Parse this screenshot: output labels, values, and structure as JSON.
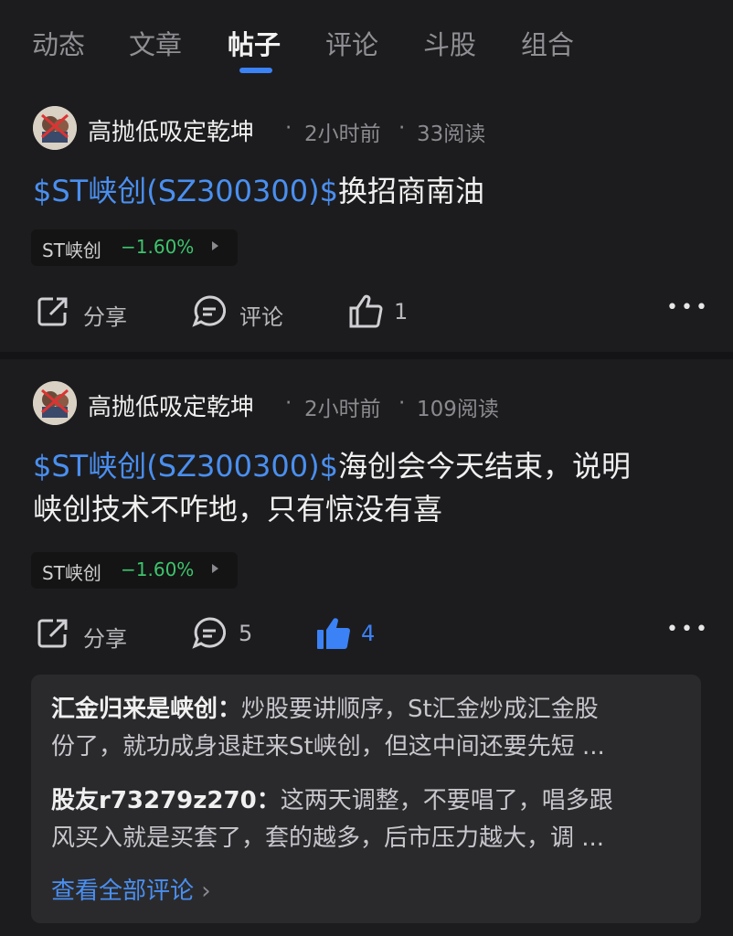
{
  "tabs": [
    "动态",
    "文章",
    "帖子",
    "评论",
    "斗股",
    "组合"
  ],
  "active_tab": "帖子",
  "posts": [
    {
      "author": "高抛低吸定乾坤",
      "time": "2小时前",
      "reads": "33阅读",
      "tag": "$ST峡创(SZ300300)$",
      "text": "换招商南油",
      "stock_name": "ST峡创",
      "stock_change": "−1.60%",
      "share_label": "分享",
      "comment_label": "评论",
      "like_count": "1"
    },
    {
      "author": "高抛低吸定乾坤",
      "time": "2小时前",
      "reads": "109阅读",
      "tag": "$ST峡创(SZ300300)$",
      "text_line1": "海创会今天结束，说明",
      "text_line2": "峡创技术不咋地，只有惊没有喜",
      "stock_name": "ST峡创",
      "stock_change": "−1.60%",
      "share_label": "分享",
      "comment_count": "5",
      "like_count": "4"
    }
  ],
  "comments": [
    {
      "user": "汇金归来是峡创",
      "line1": "炒股要讲顺序，St汇金炒成汇金股",
      "line2": "份了，就功成身退赶来St峡创，但这中间还要先短 ..."
    },
    {
      "user": "股友r73279z270",
      "line1": "这两天调整，不要唱了，唱多跟",
      "line2": "风买入就是买套了，套的越多，后市压力越大，调 ..."
    }
  ],
  "view_all_label": "查看全部评论",
  "colors": {
    "accent": "#4a8ff0",
    "down": "#3ec46d",
    "background": "#1c1c1e"
  }
}
